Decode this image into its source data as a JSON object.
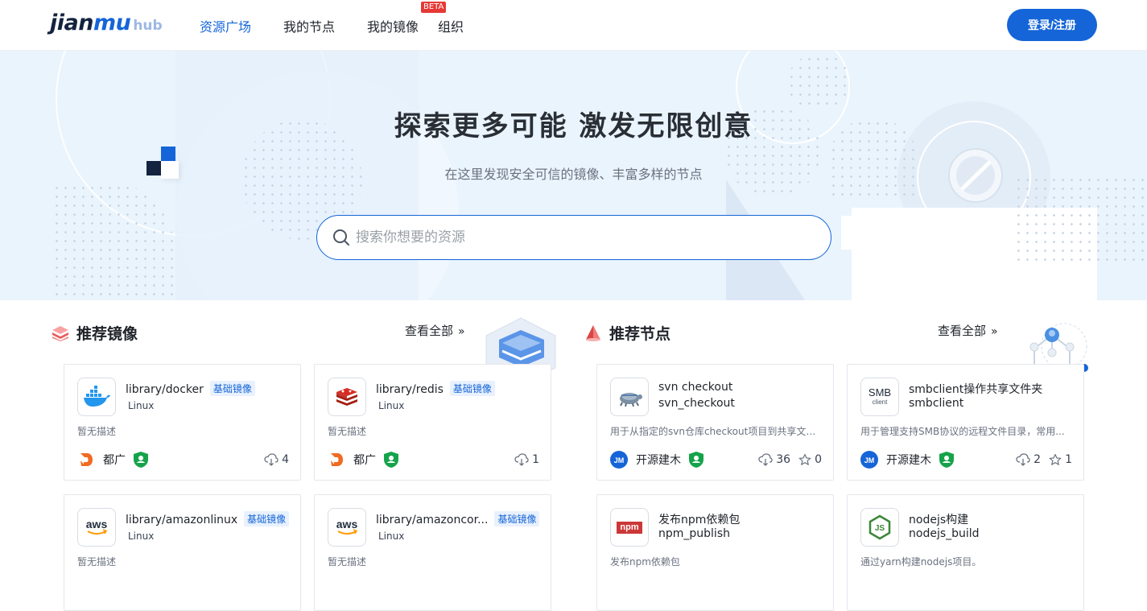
{
  "header": {
    "logo_main_a": "jian",
    "logo_main_b": "mu",
    "logo_sub": "hub",
    "nav": [
      {
        "label": "资源广场",
        "active": true
      },
      {
        "label": "我的节点"
      },
      {
        "label": "我的镜像",
        "badge": "BETA"
      },
      {
        "label": "组织"
      }
    ],
    "login_label": "登录/注册"
  },
  "hero": {
    "title": "探索更多可能 激发无限创意",
    "subtitle": "在这里发现安全可信的镜像、丰富多样的节点",
    "search_placeholder": "搜索你想要的资源"
  },
  "images_section": {
    "title": "推荐镜像",
    "view_all": "查看全部",
    "cards": [
      {
        "name": "library/docker",
        "tag": "基础镜像",
        "os": "Linux",
        "desc": "暂无描述",
        "org": "都广",
        "downloads": "4",
        "icon": "docker-icon"
      },
      {
        "name": "library/redis",
        "tag": "基础镜像",
        "os": "Linux",
        "desc": "暂无描述",
        "org": "都广",
        "downloads": "1",
        "icon": "redis-icon"
      },
      {
        "name": "library/amazonlinux",
        "tag": "基础镜像",
        "os": "Linux",
        "desc": "暂无描述",
        "icon": "aws-icon"
      },
      {
        "name": "library/amazoncor...",
        "tag": "基础镜像",
        "os": "Linux",
        "desc": "暂无描述",
        "icon": "aws-icon"
      }
    ]
  },
  "nodes_section": {
    "title": "推荐节点",
    "view_all": "查看全部",
    "cards": [
      {
        "name": "svn checkout",
        "id": "svn_checkout",
        "desc": "用于从指定的svn仓库checkout项目到共享文件...",
        "org": "开源建木",
        "downloads": "36",
        "stars": "0",
        "icon": "svn-icon"
      },
      {
        "name": "smbclient操作共享文件夹",
        "id": "smbclient",
        "desc": "用于管理支持SMB协议的远程文件目录，常用...",
        "org": "开源建木",
        "downloads": "2",
        "stars": "1",
        "icon": "smb-icon",
        "icon_text_a": "SMB",
        "icon_text_b": "client"
      },
      {
        "name": "发布npm依赖包",
        "id": "npm_publish",
        "desc": "发布npm依赖包",
        "icon": "npm-icon",
        "icon_text": "npm"
      },
      {
        "name": "nodejs构建",
        "id": "nodejs_build",
        "desc": "通过yarn构建nodejs项目。",
        "icon": "nodejs-icon",
        "icon_text": "JS"
      }
    ]
  },
  "org_initials": "JM",
  "aws_text": "aws",
  "colors": {
    "accent": "#1565d8",
    "hero_bg": "#eaf4fd",
    "badge_red": "#e53935",
    "verify_green": "#15a34a",
    "org_orange": "#f26a21"
  }
}
